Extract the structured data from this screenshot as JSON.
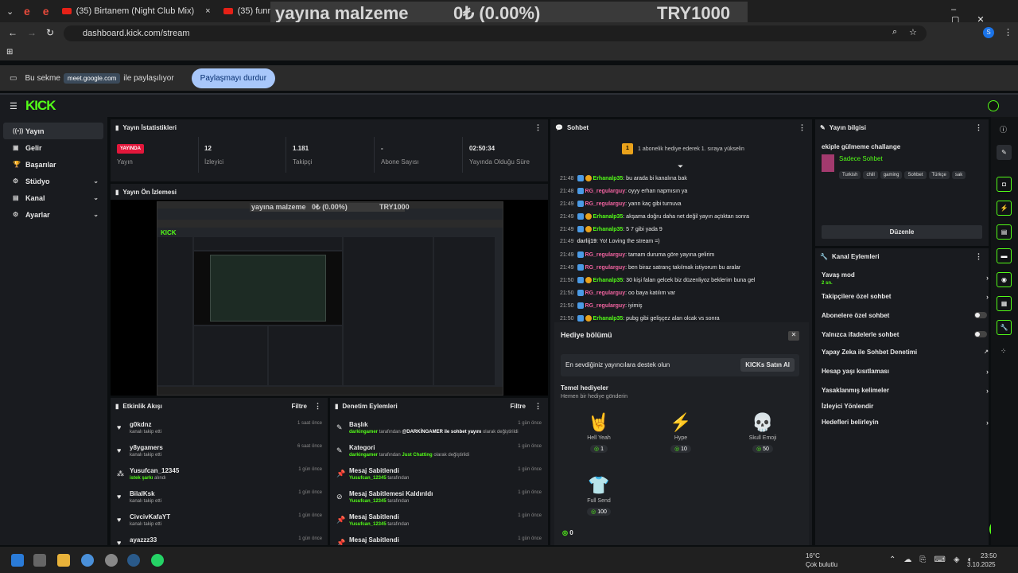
{
  "browser": {
    "tabs": [
      {
        "label": "(35) Birtanem (Night Club Mix)",
        "close": "×"
      },
      {
        "label": "(35) funny moments",
        "close": "×"
      }
    ],
    "url": "dashboard.kick.com/stream",
    "overlay": {
      "left": "yayına malzeme",
      "mid": "0₺ (0.00%)",
      "right": "TRY1000"
    },
    "profile_initial": "S",
    "share_bar": {
      "prefix": "Bu sekme",
      "site": "meet.google.com",
      "suffix": "ile paylaşılıyor",
      "stop_label": "Paylaşmayı durdur"
    }
  },
  "logo": "KICK",
  "sidebar": {
    "items": [
      {
        "label": "Yayın",
        "icon": "broadcast-icon"
      },
      {
        "label": "Gelir",
        "icon": "revenue-icon"
      },
      {
        "label": "Başarılar",
        "icon": "trophy-icon"
      },
      {
        "label": "Stüdyo",
        "icon": "studio-icon"
      },
      {
        "label": "Kanal",
        "icon": "channel-icon"
      },
      {
        "label": "Ayarlar",
        "icon": "settings-icon"
      }
    ]
  },
  "stats": {
    "title": "Yayın İstatistikleri",
    "items": [
      {
        "value": "YAYINDA",
        "label": "Yayın"
      },
      {
        "value": "12",
        "label": "İzleyici"
      },
      {
        "value": "1.181",
        "label": "Takipçi"
      },
      {
        "value": "-",
        "label": "Abone Sayısı"
      },
      {
        "value": "02:50:34",
        "label": "Yayında Olduğu Süre"
      }
    ]
  },
  "preview": {
    "title": "Yayın Ön İzlemesi",
    "overlay_left": "yayına malzeme",
    "overlay_mid": "0₺ (0.00%)",
    "overlay_right": "TRY1000"
  },
  "activity": {
    "title": "Etkinlik Akışı",
    "filter": "Filtre",
    "rows": [
      {
        "name": "g0kdnz",
        "sub": "kanalı takip etti",
        "time": "1 saat önce"
      },
      {
        "name": "y8ygamers",
        "sub": "kanalı takip etti",
        "time": "6 saat önce"
      },
      {
        "name": "Yusufcan_12345",
        "sub": "istek şarkı",
        "sub2": "alındı",
        "time": "1 gün önce"
      },
      {
        "name": "BilalKsk",
        "sub": "kanalı takip etti",
        "time": "1 gün önce"
      },
      {
        "name": "CivcivKafaYT",
        "sub": "kanalı takip etti",
        "time": "1 gün önce"
      },
      {
        "name": "ayazzz33",
        "sub": "",
        "time": "1 gün önce"
      }
    ]
  },
  "moderation": {
    "title": "Denetim Eylemleri",
    "filter": "Filtre",
    "rows": [
      {
        "name": "Başlık",
        "user": "darkingamer",
        "pre": "tarafından",
        "hl": "@DARKİNGAMER ile sohbet yayını",
        "post": "olarak değiştirildi",
        "time": "1 gün önce"
      },
      {
        "name": "Kategori",
        "user": "darkingamer",
        "pre": "tarafından",
        "hl": "Just Chatting",
        "post": "olarak değiştirildi",
        "time": "1 gün önce"
      },
      {
        "name": "Mesaj Sabitlendi",
        "user": "Yusufcan_12345",
        "pre": "tarafından",
        "hl": "",
        "post": "",
        "time": "1 gün önce"
      },
      {
        "name": "Mesaj Sabitlemesi Kaldırıldı",
        "user": "Yusufcan_12345",
        "pre": "tarafından",
        "hl": "",
        "post": "",
        "time": "1 gün önce"
      },
      {
        "name": "Mesaj Sabitlendi",
        "user": "Yusufcan_12345",
        "pre": "tarafından",
        "hl": "",
        "post": "",
        "time": "1 gün önce"
      },
      {
        "name": "Mesaj Sabitlendi",
        "user": "",
        "pre": "",
        "hl": "",
        "post": "",
        "time": "1 gün önce"
      }
    ]
  },
  "chat": {
    "title": "Sohbet",
    "goal_badge": "1",
    "goal": "1 abonelik hediye ederek 1. sıraya yükselin",
    "messages": [
      {
        "time": "21:48",
        "user": "Erhanalp35",
        "color": "g",
        "badge": "sub",
        "text": "bu arada bi kanalına bak"
      },
      {
        "time": "21:48",
        "user": "RG_regularguy",
        "color": "p",
        "badge": "",
        "text": "oyyy erhan napmısın ya"
      },
      {
        "time": "21:49",
        "user": "RG_regularguy",
        "color": "p",
        "badge": "",
        "text": "yarın kaç gibi turnuva"
      },
      {
        "time": "21:49",
        "user": "Erhanalp35",
        "color": "g",
        "badge": "sub",
        "text": "akşama doğru daha net değil yayın açtıktan sonra"
      },
      {
        "time": "21:49",
        "user": "Erhanalp35",
        "color": "g",
        "badge": "sub",
        "text": "5 7 gibi yada 9"
      },
      {
        "time": "21:49",
        "user": "darlij19",
        "color": "w",
        "badge": "none",
        "text": "Yo! Loving the stream =)"
      },
      {
        "time": "21:49",
        "user": "RG_regularguy",
        "color": "p",
        "badge": "",
        "text": "tamam duruma göre yayına gelirim"
      },
      {
        "time": "21:49",
        "user": "RG_regularguy",
        "color": "p",
        "badge": "",
        "text": "ben biraz satranç takılmak istiyorum bu aralar"
      },
      {
        "time": "21:50",
        "user": "Erhanalp35",
        "color": "g",
        "badge": "sub",
        "text": "30 kişi falan gelcek biz düzenliyoz beklerim buna gel"
      },
      {
        "time": "21:50",
        "user": "RG_regularguy",
        "color": "p",
        "badge": "",
        "text": "oo baya katılım var"
      },
      {
        "time": "21:50",
        "user": "RG_regularguy",
        "color": "p",
        "badge": "",
        "text": "iyimiş"
      },
      {
        "time": "21:50",
        "user": "Erhanalp35",
        "color": "g",
        "badge": "sub",
        "text": "pubg gibi gelişçez alan olcak vs sonra"
      }
    ]
  },
  "gift": {
    "title": "Hediye bölümü",
    "support": "En sevdiğiniz yayıncılara destek olun",
    "buy": "KICKs Satın Al",
    "basic": "Temel hediyeler",
    "basic_sub": "Hemen bir hediye gönderin",
    "items": [
      {
        "name": "Hell Yeah",
        "price": "1",
        "emoji": "🤘"
      },
      {
        "name": "Hype",
        "price": "10",
        "emoji": "⚡"
      },
      {
        "name": "Skull Emoji",
        "price": "50",
        "emoji": "💀"
      },
      {
        "name": "Full Send",
        "price": "100",
        "emoji": "👕"
      }
    ],
    "balance": "0"
  },
  "info": {
    "title": "Yayın bilgisi",
    "stream_title": "ekiple gülmeme challange",
    "category": "Sadece Sohbet",
    "tags": [
      "Turkish",
      "chill",
      "gaming",
      "Sohbet",
      "Türkçe",
      "sak"
    ],
    "edit": "Düzenle"
  },
  "channel_actions": {
    "title": "Kanal Eylemleri",
    "items": [
      {
        "label": "Yavaş mod",
        "sub": "2 sn.",
        "ctrl": "arrow"
      },
      {
        "label": "Takipçilere özel sohbet",
        "ctrl": "arrow"
      },
      {
        "label": "Abonelere özel sohbet",
        "ctrl": "toggle"
      },
      {
        "label": "Yalnızca ifadelerle sohbet",
        "ctrl": "toggle"
      },
      {
        "label": "Yapay Zeka ile Sohbet Denetimi",
        "ctrl": "ext"
      },
      {
        "label": "Hesap yaşı kısıtlaması",
        "ctrl": "arrow"
      },
      {
        "label": "Yasaklanmış kelimeler",
        "ctrl": "arrow"
      },
      {
        "label": "İzleyici Yönlendir",
        "ctrl": "none"
      },
      {
        "label": "Hedefleri belirleyin",
        "ctrl": "arrow"
      }
    ]
  },
  "taskbar": {
    "temp": "16°C",
    "weather": "Çok bulutlu",
    "time": "23:50",
    "date": "3.10.2025"
  },
  "colors": {
    "kick_green": "#53fc18",
    "live_red": "#e2173b",
    "panel": "#191b1f"
  }
}
